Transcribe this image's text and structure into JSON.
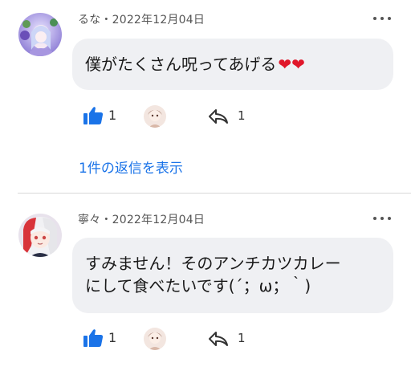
{
  "comments": [
    {
      "author": "るな",
      "separator": "・",
      "date": "2022年12月04日",
      "text": "僕がたくさん呪ってあげる",
      "hearts": "❤❤",
      "like_count": "1",
      "reply_count": "1",
      "replies_link": "1件の返信を表示"
    },
    {
      "author": "寧々",
      "separator": "・",
      "date": "2022年12月04日",
      "text": "すみません！そのアンチカツカレー\nにして食べたいです(´；ω；｀)",
      "like_count": "1",
      "reply_count": "1"
    }
  ],
  "colors": {
    "link": "#1a73e8",
    "like": "#1a73e8",
    "bubble": "#eff0f3",
    "heart": "#e0172a"
  },
  "icons": {
    "more": "more-dots-icon",
    "like": "thumbs-up-icon",
    "reply": "reply-arrow-icon"
  }
}
